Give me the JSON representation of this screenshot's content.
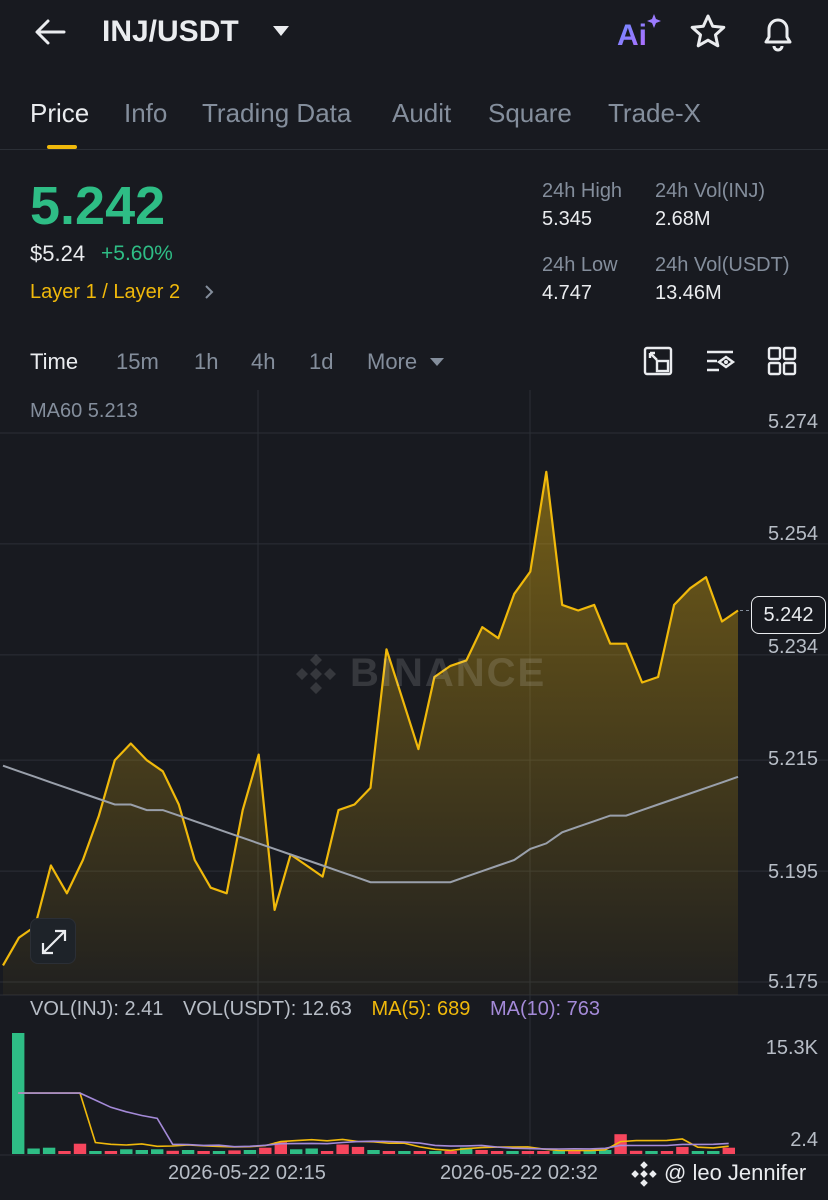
{
  "header": {
    "pair": "INJ/USDT",
    "ai_label": "Ai"
  },
  "tabs": [
    "Price",
    "Info",
    "Trading Data",
    "Audit",
    "Square",
    "Trade-X"
  ],
  "ticker": {
    "last_price": "5.242",
    "usd_price": "$5.24",
    "change_pct": "+5.60%",
    "tag": "Layer 1 / Layer 2",
    "stats": {
      "high_label": "24h High",
      "high_value": "5.345",
      "vol_base_label": "24h Vol(INJ)",
      "vol_base_value": "2.68M",
      "low_label": "24h Low",
      "low_value": "4.747",
      "vol_quote_label": "24h Vol(USDT)",
      "vol_quote_value": "13.46M"
    }
  },
  "intervals": [
    "Time",
    "15m",
    "1h",
    "4h",
    "1d",
    "More"
  ],
  "chart": {
    "ma60_label": "MA60 5.213",
    "current_price": "5.242",
    "watermark": "BINANCE",
    "price_ticks": [
      "5.274",
      "5.254",
      "5.234",
      "5.215",
      "5.195",
      "5.175"
    ],
    "volume_legend": {
      "vol_base": "VOL(INJ): 2.41",
      "vol_quote": "VOL(USDT): 12.63",
      "ma5": "MA(5): 689",
      "ma10": "MA(10): 763"
    },
    "volume_ticks": [
      "15.3K",
      "2.4"
    ],
    "time_labels": [
      "2026-05-22 02:15",
      "2026-05-22 02:32"
    ],
    "credit": "@ leo Jennifer",
    "colors": {
      "up": "#2ebd85",
      "down": "#f6465d",
      "line": "#f0b90b",
      "ma": "#9aa0ab",
      "ma10": "#a48ad8"
    }
  },
  "chart_data": {
    "type": "area",
    "title": "",
    "ylim": [
      5.175,
      5.274
    ],
    "yticks": [
      5.274,
      5.254,
      5.234,
      5.215,
      5.195,
      5.175
    ],
    "price": [
      5.178,
      5.183,
      5.185,
      5.196,
      5.191,
      5.197,
      5.205,
      5.215,
      5.218,
      5.215,
      5.213,
      5.207,
      5.197,
      5.192,
      5.191,
      5.206,
      5.216,
      5.188,
      5.198,
      5.196,
      5.194,
      5.206,
      5.207,
      5.21,
      5.235,
      5.226,
      5.217,
      5.23,
      5.232,
      5.233,
      5.239,
      5.237,
      5.245,
      5.249,
      5.267,
      5.243,
      5.242,
      5.243,
      5.236,
      5.236,
      5.229,
      5.23,
      5.243,
      5.246,
      5.248,
      5.24,
      5.242
    ],
    "ma60": [
      5.214,
      5.213,
      5.212,
      5.211,
      5.21,
      5.209,
      5.208,
      5.207,
      5.207,
      5.206,
      5.206,
      5.205,
      5.204,
      5.203,
      5.202,
      5.201,
      5.2,
      5.199,
      5.198,
      5.197,
      5.196,
      5.195,
      5.194,
      5.193,
      5.193,
      5.193,
      5.193,
      5.193,
      5.193,
      5.194,
      5.195,
      5.196,
      5.197,
      5.199,
      5.2,
      5.202,
      5.203,
      5.204,
      5.205,
      5.205,
      5.206,
      5.207,
      5.208,
      5.209,
      5.21,
      5.211,
      5.212
    ],
    "volume": [
      {
        "v": 15300,
        "up": true
      },
      {
        "v": 700,
        "up": true
      },
      {
        "v": 800,
        "up": true
      },
      {
        "v": 200,
        "up": false
      },
      {
        "v": 1300,
        "up": false
      },
      {
        "v": 300,
        "up": true
      },
      {
        "v": 200,
        "up": false
      },
      {
        "v": 600,
        "up": true
      },
      {
        "v": 500,
        "up": true
      },
      {
        "v": 600,
        "up": true
      },
      {
        "v": 400,
        "up": false
      },
      {
        "v": 500,
        "up": true
      },
      {
        "v": 350,
        "up": false
      },
      {
        "v": 300,
        "up": true
      },
      {
        "v": 450,
        "up": false
      },
      {
        "v": 500,
        "up": true
      },
      {
        "v": 800,
        "up": false
      },
      {
        "v": 1500,
        "up": false
      },
      {
        "v": 600,
        "up": true
      },
      {
        "v": 700,
        "up": true
      },
      {
        "v": 200,
        "up": false
      },
      {
        "v": 1200,
        "up": false
      },
      {
        "v": 900,
        "up": false
      },
      {
        "v": 500,
        "up": true
      },
      {
        "v": 300,
        "up": false
      },
      {
        "v": 200,
        "up": true
      },
      {
        "v": 150,
        "up": false
      },
      {
        "v": 200,
        "up": true
      },
      {
        "v": 180,
        "up": false
      },
      {
        "v": 800,
        "up": true
      },
      {
        "v": 500,
        "up": false
      },
      {
        "v": 300,
        "up": false
      },
      {
        "v": 200,
        "up": true
      },
      {
        "v": 250,
        "up": false
      },
      {
        "v": 150,
        "up": false
      },
      {
        "v": 120,
        "up": true
      },
      {
        "v": 300,
        "up": false
      },
      {
        "v": 150,
        "up": true
      },
      {
        "v": 500,
        "up": true
      },
      {
        "v": 2500,
        "up": false
      },
      {
        "v": 400,
        "up": false
      },
      {
        "v": 300,
        "up": true
      },
      {
        "v": 200,
        "up": false
      },
      {
        "v": 900,
        "up": false
      },
      {
        "v": 150,
        "up": true
      },
      {
        "v": 200,
        "up": true
      },
      {
        "v": 800,
        "up": false
      }
    ],
    "vol_ylim": [
      0,
      15300
    ]
  }
}
